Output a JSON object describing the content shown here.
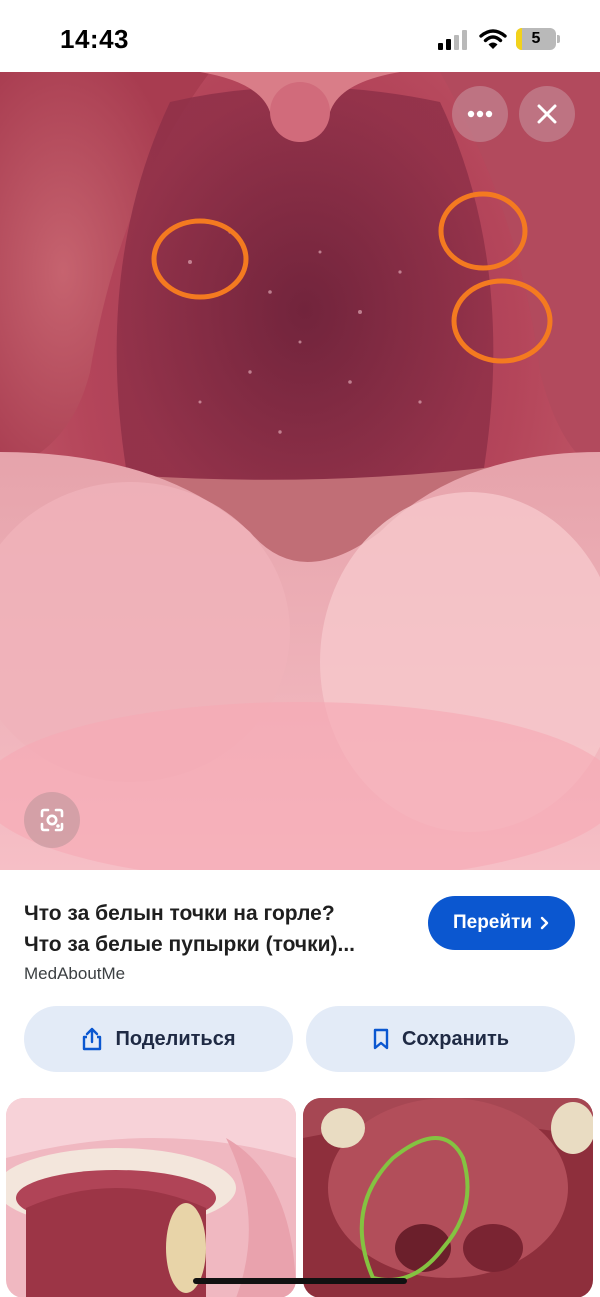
{
  "status_bar": {
    "time": "14:43",
    "battery_level": "5",
    "icons": [
      "signal-icon",
      "wifi-icon",
      "battery-icon"
    ]
  },
  "image_viewer": {
    "controls": [
      "more-options-icon",
      "close-icon",
      "google-lens-icon"
    ],
    "annotation_color": "#f47a20"
  },
  "result": {
    "title_line1": "Что за белын точки на горле?",
    "title_line2": "Что за белые пупырки (точки)...",
    "source": "MedAboutMe",
    "visit_label": "Перейти"
  },
  "actions": {
    "share_label": "Поделиться",
    "save_label": "Сохранить"
  },
  "colors": {
    "visit_button": "#0b57d0",
    "pill_background": "#e3ebf7"
  }
}
